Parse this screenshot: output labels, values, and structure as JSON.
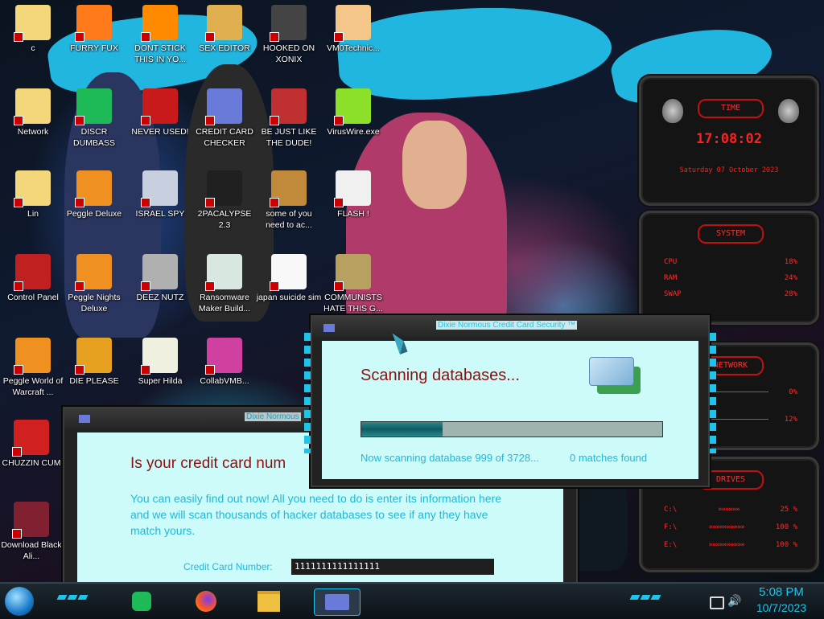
{
  "desktop": {
    "icons": [
      {
        "label": "c",
        "icon": "star-butterfly-icon",
        "color": "#f3d77a"
      },
      {
        "label": "FURRY FUX",
        "icon": "firefox-icon",
        "color": "#ff7a1a"
      },
      {
        "label": "DONT STICK THIS IN YO...",
        "icon": "vlc-cone-icon",
        "color": "#ff8a00"
      },
      {
        "label": "SEX EDITOR",
        "icon": "hxd-editor-icon",
        "color": "#e0b050"
      },
      {
        "label": "HOOKED ON XONIX",
        "icon": "xonix-game-icon",
        "color": "#444444"
      },
      {
        "label": "VM0Technic...",
        "icon": "doctor-icon",
        "color": "#f5c68a"
      },
      {
        "label": "Network",
        "icon": "star-butterfly-icon",
        "color": "#f3d77a"
      },
      {
        "label": "DISCR DUMBASS",
        "icon": "google-chat-icon",
        "color": "#1fba58"
      },
      {
        "label": "NEVER USED!",
        "icon": "dev-plus-icon",
        "color": "#c81a1a"
      },
      {
        "label": "CREDIT CARD CHECKER",
        "icon": "credit-card-icon",
        "color": "#6a7ad8"
      },
      {
        "label": "BE JUST LIKE THE DUDE!",
        "icon": "santa-icon",
        "color": "#c03030"
      },
      {
        "label": "VirusWire.exe",
        "icon": "lime-icon",
        "color": "#8de02a"
      },
      {
        "label": "Lin",
        "icon": "star-butterfly-icon",
        "color": "#f3d77a"
      },
      {
        "label": "Peggle Deluxe",
        "icon": "peggle-icon",
        "color": "#f09020"
      },
      {
        "label": "ISRAEL SPY",
        "icon": "spy-cloud-icon",
        "color": "#c8d0e0"
      },
      {
        "label": "2PACALYPSE 2.3",
        "icon": "terminal-icon",
        "color": "#202020"
      },
      {
        "label": "some of you need to ac...",
        "icon": "beaver-icon",
        "color": "#c08a3a"
      },
      {
        "label": "FLASH !",
        "icon": "flash-doc-icon",
        "color": "#f0f0f0"
      },
      {
        "label": "Control Panel",
        "icon": "control-panel-icon",
        "color": "#c02020"
      },
      {
        "label": "Peggle Nights Deluxe",
        "icon": "peggle-icon",
        "color": "#f09020"
      },
      {
        "label": "DEEZ NUTZ",
        "icon": "stacked-windows-icon",
        "color": "#b0b0b0"
      },
      {
        "label": "Ransomware Maker Build...",
        "icon": "app-window-icon",
        "color": "#d8e8e0"
      },
      {
        "label": "japan suicide sim",
        "icon": "document-icon",
        "color": "#f8f8f8"
      },
      {
        "label": "COMMUNISTS HATE THIS G...",
        "icon": "money-bag-icon",
        "color": "#b8a060"
      },
      {
        "label": "Peggle World of Warcraft ...",
        "icon": "peggle-icon",
        "color": "#f09020"
      },
      {
        "label": "DIE PLEASE",
        "icon": "de-logo-icon",
        "color": "#e8a020"
      },
      {
        "label": "Super Hilda",
        "icon": "pixel-cat-icon",
        "color": "#f0f0e0"
      },
      {
        "label": "CollabVMB...",
        "icon": "collabvm-icon",
        "color": "#d040a0"
      },
      {
        "label": "CHUZZIN CUM",
        "icon": "chuzzle-icon",
        "color": "#d02020"
      },
      {
        "label": "Download Black Ali...",
        "icon": "black-orb-icon",
        "color": "#802030"
      }
    ]
  },
  "widgets": {
    "time": {
      "title": "TIME",
      "clock": "17:08:02",
      "date": "Saturday 07 October 2023"
    },
    "system": {
      "title": "SYSTEM",
      "rows": [
        {
          "label": "CPU",
          "value": "18%"
        },
        {
          "label": "RAM",
          "value": "24%"
        },
        {
          "label": "SWAP",
          "value": "28%"
        }
      ]
    },
    "network": {
      "title": "NETWORK",
      "rows": [
        {
          "value": "0%"
        },
        {
          "value": "12%"
        }
      ]
    },
    "drives": {
      "title": "DRIVES",
      "rows": [
        {
          "label": "C:\\",
          "value": "25 %"
        },
        {
          "label": "F:\\",
          "value": "100 %"
        },
        {
          "label": "E:\\",
          "value": "100 %"
        }
      ]
    }
  },
  "back_window": {
    "title": "Dixie Normous",
    "heading": "Is your credit card num",
    "description": "You can easily find out now! All you need to do is enter its information here and we will scan thousands of hacker databases to see if any they have match yours.",
    "cc_label": "Credit Card Number:",
    "cc_value": "1111111111111111"
  },
  "front_window": {
    "title": "Dixie Normous Credit Card Security ™",
    "heading": "Scanning databases...",
    "progress": 0.27,
    "status": "Now scanning database 999 of 3728...",
    "matches": "0 matches found"
  },
  "taskbar": {
    "items": [
      "google-chat-icon",
      "firefox-icon",
      "file-explorer-icon",
      "credit-card-icon"
    ],
    "time": "5:08 PM",
    "date": "10/7/2023"
  },
  "colors": {
    "accent": "#1fc4ea",
    "widget_red": "#ff2a2a",
    "client_bg": "#cdfbfa",
    "heading_red": "#8a1010"
  }
}
